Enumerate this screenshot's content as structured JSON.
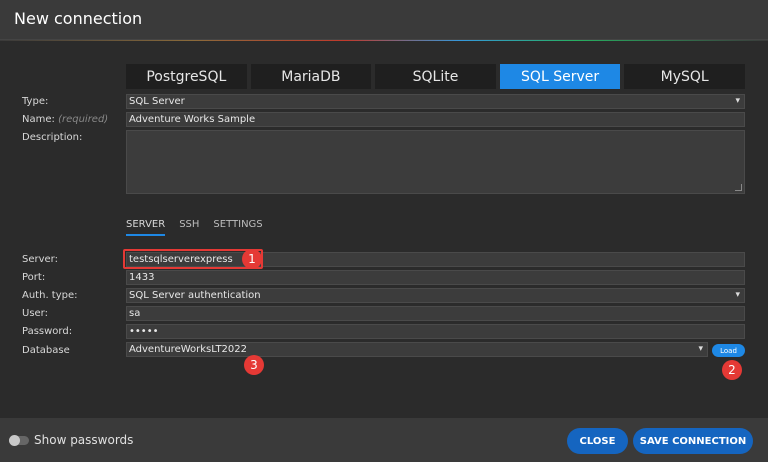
{
  "window": {
    "title": "New connection"
  },
  "db_tabs": [
    {
      "label": "PostgreSQL",
      "active": false
    },
    {
      "label": "MariaDB",
      "active": false
    },
    {
      "label": "SQLite",
      "active": false
    },
    {
      "label": "SQL Server",
      "active": true
    },
    {
      "label": "MySQL",
      "active": false
    }
  ],
  "form": {
    "type": {
      "label": "Type:",
      "value": "SQL Server"
    },
    "name": {
      "label": "Name:",
      "required": "(required)",
      "value": "Adventure Works Sample"
    },
    "description": {
      "label": "Description:",
      "value": ""
    }
  },
  "sub_tabs": [
    {
      "label": "SERVER",
      "active": true
    },
    {
      "label": "SSH",
      "active": false
    },
    {
      "label": "SETTINGS",
      "active": false
    }
  ],
  "server": {
    "server": {
      "label": "Server:",
      "value": "testsqlserverexpress"
    },
    "port": {
      "label": "Port:",
      "value": "1433"
    },
    "auth": {
      "label": "Auth. type:",
      "value": "SQL Server authentication"
    },
    "user": {
      "label": "User:",
      "value": "sa"
    },
    "password": {
      "label": "Password:",
      "value": "•••••"
    },
    "database": {
      "label": "Database",
      "value": "AdventureWorksLT2022"
    },
    "load_label": "Load"
  },
  "annotations": {
    "one": "1",
    "two": "2",
    "three": "3"
  },
  "footer": {
    "show_passwords": "Show passwords",
    "close": "CLOSE",
    "save": "SAVE CONNECTION"
  },
  "colors": {
    "accent": "#1e88e5",
    "annotation": "#e53935"
  }
}
